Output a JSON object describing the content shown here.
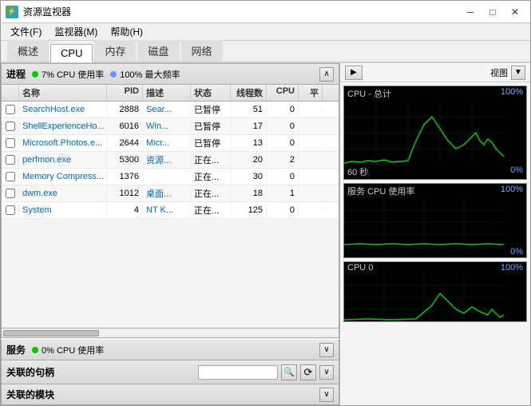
{
  "window": {
    "title": "资源监视器",
    "icon": "📊"
  },
  "menu": {
    "items": [
      "文件(F)",
      "监视器(M)",
      "帮助(H)"
    ]
  },
  "nav_tabs": {
    "items": [
      "概述",
      "CPU",
      "内存",
      "磁盘",
      "网络"
    ],
    "active": "CPU"
  },
  "process_section": {
    "title": "进程",
    "cpu_indicator": "7% CPU 使用率",
    "freq_indicator": "100% 最大频率",
    "columns": [
      "名称",
      "PID",
      "描述",
      "状态",
      "线程数",
      "CPU",
      "平"
    ],
    "rows": [
      {
        "name": "SearchHost.exe",
        "pid": "2888",
        "desc": "Sear...",
        "status": "已暂停",
        "threads": "51",
        "cpu": "0",
        "avg": ""
      },
      {
        "name": "ShellExperienceHo...",
        "pid": "6016",
        "desc": "Win...",
        "status": "已暂停",
        "threads": "17",
        "cpu": "0",
        "avg": ""
      },
      {
        "name": "Microsoft.Photos.e...",
        "pid": "2644",
        "desc": "Micr...",
        "status": "已暂停",
        "threads": "13",
        "cpu": "0",
        "avg": ""
      },
      {
        "name": "perfmon.exe",
        "pid": "5300",
        "desc": "资源...",
        "status": "正在...",
        "threads": "20",
        "cpu": "2",
        "avg": ""
      },
      {
        "name": "Memory Compress...",
        "pid": "1376",
        "desc": "",
        "status": "正在...",
        "threads": "30",
        "cpu": "0",
        "avg": ""
      },
      {
        "name": "dwm.exe",
        "pid": "1012",
        "desc": "桌面...",
        "status": "正在...",
        "threads": "18",
        "cpu": "1",
        "avg": ""
      },
      {
        "name": "System",
        "pid": "4",
        "desc": "NT K...",
        "status": "正在...",
        "threads": "125",
        "cpu": "0",
        "avg": ""
      }
    ]
  },
  "services_section": {
    "title": "服务",
    "cpu_indicator": "0% CPU 使用率"
  },
  "handles_section": {
    "title": "关联的句柄",
    "search_placeholder": ""
  },
  "modules_section": {
    "title": "关联的模块"
  },
  "right_panel": {
    "view_label": "视图",
    "charts": [
      {
        "id": "cpu-total",
        "label": "CPU - 总计",
        "value": "100%",
        "time_label": "60 秒",
        "pct_label": "0%"
      },
      {
        "id": "cpu-service",
        "label": "服务 CPU 使用率",
        "value": "100%",
        "time_label": "",
        "pct_label": "0%"
      },
      {
        "id": "cpu-0",
        "label": "CPU 0",
        "value": "100%",
        "time_label": "",
        "pct_label": ""
      }
    ]
  }
}
